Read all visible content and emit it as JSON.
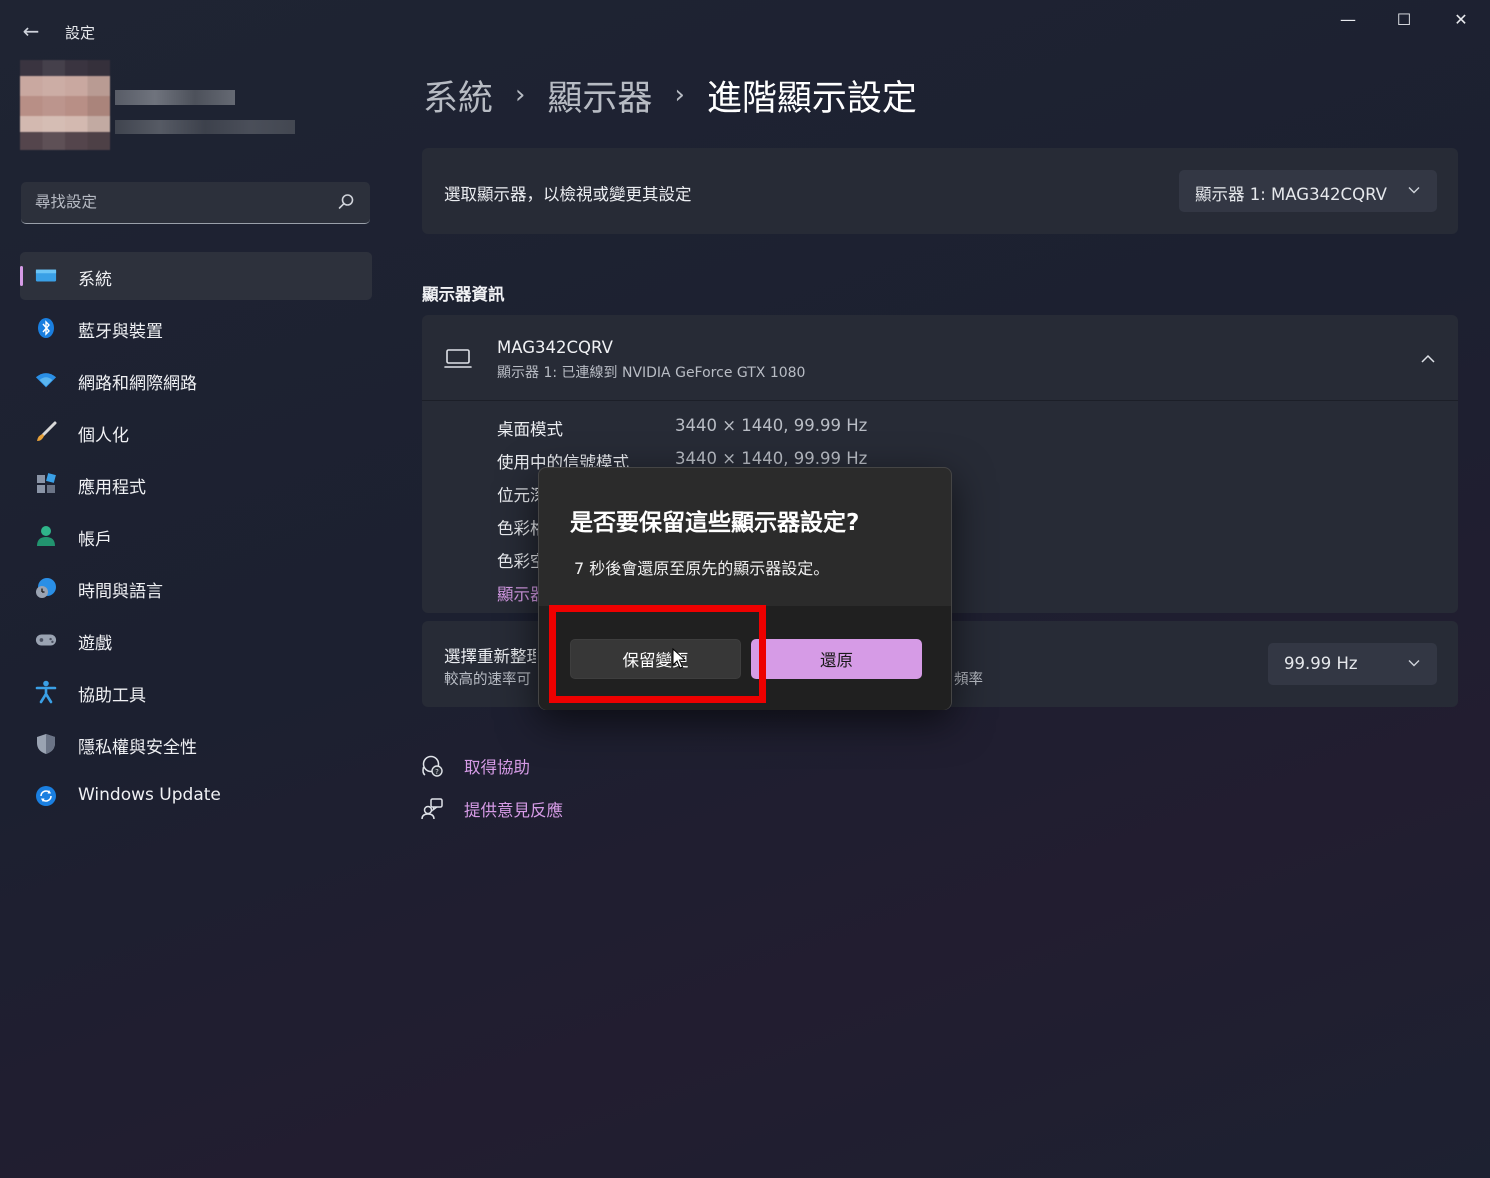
{
  "window": {
    "title": "設定",
    "controls": {
      "minimize": "—",
      "maximize": "☐",
      "close": "✕"
    }
  },
  "search": {
    "placeholder": "尋找設定"
  },
  "sidebar": {
    "items": [
      {
        "label": "系統",
        "icon": "system-icon",
        "active": true
      },
      {
        "label": "藍牙與裝置",
        "icon": "bluetooth-icon"
      },
      {
        "label": "網路和網際網路",
        "icon": "wifi-icon"
      },
      {
        "label": "個人化",
        "icon": "brush-icon"
      },
      {
        "label": "應用程式",
        "icon": "apps-icon"
      },
      {
        "label": "帳戶",
        "icon": "account-icon"
      },
      {
        "label": "時間與語言",
        "icon": "globe-clock-icon"
      },
      {
        "label": "遊戲",
        "icon": "gamepad-icon"
      },
      {
        "label": "協助工具",
        "icon": "accessibility-icon"
      },
      {
        "label": "隱私權與安全性",
        "icon": "shield-icon"
      },
      {
        "label": "Windows Update",
        "icon": "windows-update-icon"
      }
    ]
  },
  "breadcrumb": {
    "items": [
      "系統",
      "顯示器",
      "進階顯示設定"
    ],
    "separator": "›"
  },
  "display_select": {
    "text": "選取顯示器，以檢視或變更其設定",
    "value": "顯示器 1: MAG342CQRV"
  },
  "display_info": {
    "section_title": "顯示器資訊",
    "monitor_name": "MAG342CQRV",
    "monitor_sub": "顯示器 1: 已連線到 NVIDIA GeForce GTX 1080",
    "rows": [
      {
        "label": "桌面模式",
        "value": "3440 × 1440, 99.99 Hz"
      },
      {
        "label": "使用中的信號模式",
        "value": "3440 × 1440, 99.99 Hz"
      },
      {
        "label": "位元深",
        "value": ""
      },
      {
        "label": "色彩格",
        "value": ""
      },
      {
        "label": "色彩空",
        "value": ""
      }
    ],
    "link": "顯示器"
  },
  "refresh": {
    "title": "選擇重新整理",
    "subtitle": "較高的速率可",
    "subtitle_end": "頻率",
    "value": "99.99 Hz"
  },
  "help": {
    "get_help": "取得協助",
    "feedback": "提供意見反應"
  },
  "dialog": {
    "title": "是否要保留這些顯示器設定?",
    "body": "7 秒後會還原至原先的顯示器設定。",
    "keep_button": "保留變更",
    "revert_button": "還原"
  },
  "colors": {
    "accent": "#d69be6",
    "highlight": "#ee0000",
    "card": "#272b36"
  }
}
